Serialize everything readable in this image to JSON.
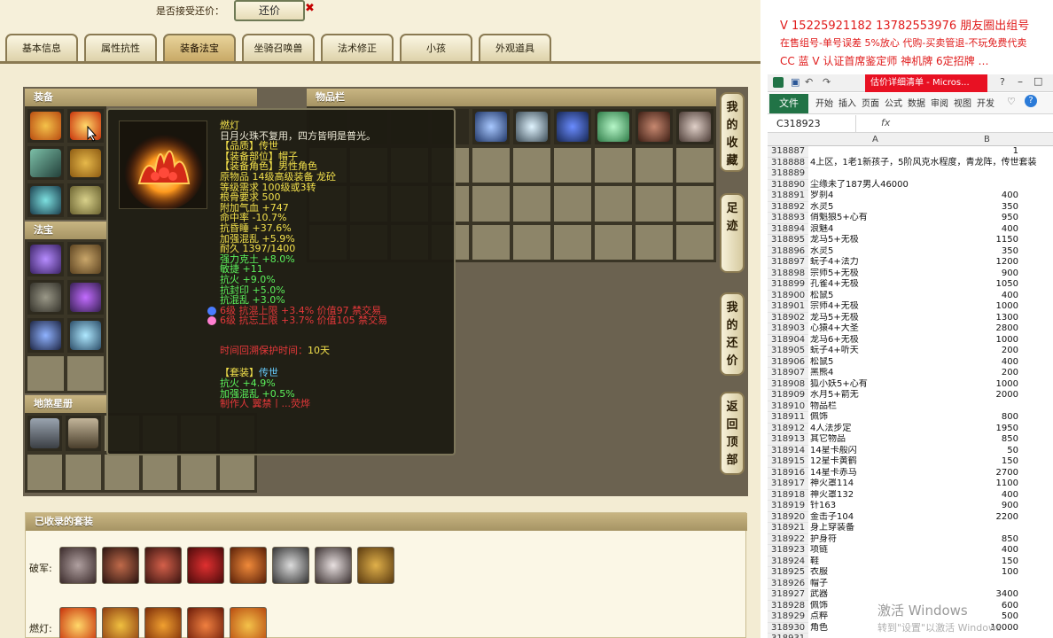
{
  "top": {
    "accept_label": "是否接受还价：",
    "counter_button": "还价",
    "close_mark": "✖"
  },
  "tabs": [
    "基本信息",
    "属性抗性",
    "装备法宝",
    "坐骑召唤兽",
    "法术修正",
    "小孩",
    "外观道具"
  ],
  "sections": {
    "equipment": "装备",
    "items": "物品栏",
    "magic": "法宝",
    "bestiary": "地煞星册",
    "collected_sets": "已收录的套装"
  },
  "side_buttons": [
    "我的收藏",
    "足迹",
    "我的还价",
    "返回顶部"
  ],
  "collected": {
    "row1_label": "破军:",
    "row2_label": "燃灯:"
  },
  "tooltip": {
    "name": "燃灯",
    "desc": "日月火珠不复用，四方皆明是普光。",
    "lines": [
      {
        "t": "【品质】传世",
        "c": "c-y"
      },
      {
        "t": "【装备部位】帽子",
        "c": "c-y"
      },
      {
        "t": "【装备角色】男性角色",
        "c": "c-y"
      },
      {
        "t": "原物品 14级高级装备 龙砼",
        "c": "c-y"
      },
      {
        "t": "等级需求 100级或3转",
        "c": "c-y"
      },
      {
        "t": "根骨要求 500",
        "c": "c-y"
      },
      {
        "t": "附加气血 +747",
        "c": "c-y"
      },
      {
        "t": "命中率 -10.7%",
        "c": "c-y"
      },
      {
        "t": "抗昏睡 +37.6%",
        "c": "c-y"
      },
      {
        "t": "加强混乱 +5.9%",
        "c": "c-y"
      },
      {
        "t": "耐久 1397/1400",
        "c": "c-y"
      },
      {
        "t": "强力克土 +8.0%",
        "c": "c-g"
      },
      {
        "t": "敏捷 +11",
        "c": "c-g"
      },
      {
        "t": "抗火 +9.0%",
        "c": "c-g"
      },
      {
        "t": "抗封印 +5.0%",
        "c": "c-g"
      },
      {
        "t": "抗混乱 +3.0%",
        "c": "c-g"
      },
      {
        "t": "6级 抗混上限 +3.4% 价值97 禁交易",
        "c": "c-r",
        "gem": "#4a7cff"
      },
      {
        "t": "6级 抗忘上限 +3.7% 价值105 禁交易",
        "c": "c-r",
        "gem": "#ff7fd0"
      }
    ],
    "protect_label": "时间回溯保护时间：",
    "protect_value": "10天",
    "set_title": "【套装】",
    "set_name": "传世",
    "set_lines": [
      {
        "t": "抗火 +4.9%",
        "c": "c-g"
      },
      {
        "t": "加强混乱 +0.5%",
        "c": "c-g"
      },
      {
        "t": "制作人 翼禁丨...荧烨",
        "c": "c-r"
      }
    ]
  },
  "promo": {
    "line1": "V 15225921182    13782553976 朋友圈出组号",
    "line2": "在售组号-单号误差 5%放心 代购-买卖管退-不玩免费代卖",
    "line3": "CC 蓝 V 认证首席鉴定师 神机牌 6定招牌 …"
  },
  "excel": {
    "title": "估价详细清单 - Micros...",
    "file_tab": "文件",
    "ribbon_tabs": [
      "开始",
      "插入",
      "页面",
      "公式",
      "数据",
      "审阅",
      "视图",
      "开发"
    ],
    "name_box": "C318923",
    "fx": "fx",
    "col_a": "A",
    "col_b": "B",
    "watermark": "激活 Windows",
    "watermark_sub": "转到\"设置\"以激活 Windows",
    "rows": [
      {
        "n": "318887",
        "a": "",
        "b": "1",
        "wide": false
      },
      {
        "n": "318888",
        "a": "4上区，1老1新孩子，5阶风克水程度，青龙阵，传世套装",
        "b": "",
        "wide": true
      },
      {
        "n": "318889",
        "a": "",
        "b": "",
        "wide": false
      },
      {
        "n": "318890",
        "a": "尘缘未了187男人46000",
        "b": "",
        "wide": true
      },
      {
        "n": "318891",
        "a": "罗刹4",
        "b": "400"
      },
      {
        "n": "318892",
        "a": "水灵5",
        "b": "350"
      },
      {
        "n": "318893",
        "a": "俏魁狼5+心有",
        "b": "950"
      },
      {
        "n": "318894",
        "a": "浪魅4",
        "b": "400"
      },
      {
        "n": "318895",
        "a": "龙马5+无极",
        "b": "1150"
      },
      {
        "n": "318896",
        "a": "水灵5",
        "b": "350"
      },
      {
        "n": "318897",
        "a": "蚖子4+法力",
        "b": "1200"
      },
      {
        "n": "318898",
        "a": "宗师5+无极",
        "b": "900"
      },
      {
        "n": "318899",
        "a": "孔雀4+无极",
        "b": "1050"
      },
      {
        "n": "318900",
        "a": "松鼠5",
        "b": "400"
      },
      {
        "n": "318901",
        "a": "宗师4+无极",
        "b": "1000"
      },
      {
        "n": "318902",
        "a": "龙马5+无极",
        "b": "1300"
      },
      {
        "n": "318903",
        "a": "心猿4+大圣",
        "b": "2800"
      },
      {
        "n": "318904",
        "a": "龙马6+无极",
        "b": "1000"
      },
      {
        "n": "318905",
        "a": "蚖子4+听天",
        "b": "200"
      },
      {
        "n": "318906",
        "a": "松鼠5",
        "b": "400"
      },
      {
        "n": "318907",
        "a": "黑熊4",
        "b": "200"
      },
      {
        "n": "318908",
        "a": "狐小妖5+心有",
        "b": "1000"
      },
      {
        "n": "318909",
        "a": "水月5+箭无",
        "b": "2000"
      },
      {
        "n": "318910",
        "a": "物品栏",
        "b": ""
      },
      {
        "n": "318911",
        "a": "佩饰",
        "b": "800"
      },
      {
        "n": "318912",
        "a": "4人法步定",
        "b": "1950"
      },
      {
        "n": "318913",
        "a": "其它物品",
        "b": "850"
      },
      {
        "n": "318914",
        "a": "14星卡般闪",
        "b": "50"
      },
      {
        "n": "318915",
        "a": "12星卡黄鹤",
        "b": "150"
      },
      {
        "n": "318916",
        "a": "14星卡赤马",
        "b": "2700"
      },
      {
        "n": "318917",
        "a": "神火罩114",
        "b": "1100"
      },
      {
        "n": "318918",
        "a": "神火罩132",
        "b": "400"
      },
      {
        "n": "318919",
        "a": "针163",
        "b": "900"
      },
      {
        "n": "318920",
        "a": "金击子104",
        "b": "2200"
      },
      {
        "n": "318921",
        "a": "身上穿装备",
        "b": ""
      },
      {
        "n": "318922",
        "a": "护身符",
        "b": "850"
      },
      {
        "n": "318923",
        "a": "项链",
        "b": "400"
      },
      {
        "n": "318924",
        "a": "鞋",
        "b": "150"
      },
      {
        "n": "318925",
        "a": "衣服",
        "b": "100"
      },
      {
        "n": "318926",
        "a": "帽子",
        "b": ""
      },
      {
        "n": "318927",
        "a": "武器",
        "b": "3400"
      },
      {
        "n": "318928",
        "a": "佩饰",
        "b": "600"
      },
      {
        "n": "318929",
        "a": "点粹",
        "b": "500"
      },
      {
        "n": "318930",
        "a": "角色",
        "b": "10000"
      },
      {
        "n": "318931",
        "a": "",
        "b": ""
      }
    ]
  }
}
